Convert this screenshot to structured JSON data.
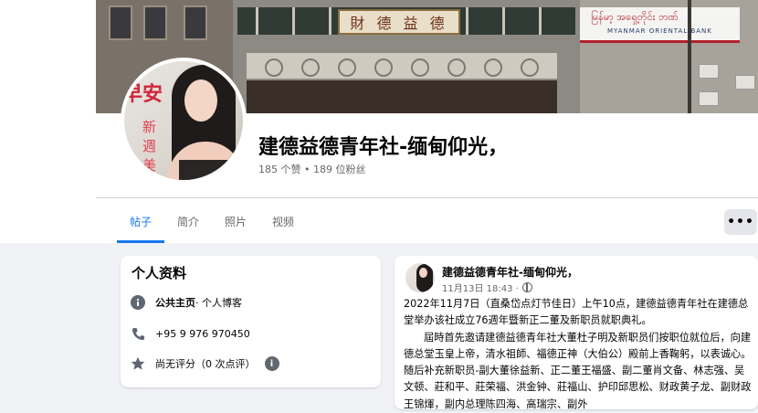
{
  "page": {
    "name": "建德益德青年社-缅甸仰光，",
    "stats": "185 个赞 • 189 位粉丝"
  },
  "cover": {
    "sign_text": "財 德 益 德",
    "bank_line1": "မြန်မာ့ အရှေ့တိုင်း ဘဏ်",
    "bank_line2": "MYANMAR ORIENTAL BANK"
  },
  "avatar": {
    "text_top": "早安",
    "text_side": "新週美"
  },
  "tabs": [
    {
      "label": "帖子",
      "active": true
    },
    {
      "label": "简介",
      "active": false
    },
    {
      "label": "照片",
      "active": false
    },
    {
      "label": "视频",
      "active": false
    }
  ],
  "more_button": "•••",
  "intro": {
    "title": "个人资料",
    "category_bold": "公共主页",
    "category_rest": " · 个人博客",
    "phone": "+95 9 976 970450",
    "rating": "尚无评分（0 次点评）"
  },
  "post": {
    "author": "建德益德青年社-缅甸仰光，",
    "time": "11月13日 18:43 ·",
    "paragraph1": "2022年11月7日（直桑岱点灯节佳日）上午10点，建德益德青年社在建德总堂举办该社成立76週年暨新正二董及新职员就职典礼。",
    "paragraph2": "屆時首先邀请建德益德青年社大董杜子明及新职员们按职位就位后，向建德总堂玉皇上帝，清水祖師、福德正神（大伯公）殿前上香鞠躬，以表诚心。随后补充新职员-副大董徐益新、正二董王福盛、副二董肖文备、林志强、吴文顿、莊和平、莊荣福、洪金钟、莊福山、护印邱思松、财政黄子龙、副财政王锦煇，副内总理陈四海、高瑞宗、副外"
  },
  "colors": {
    "accent": "#1877f2",
    "background": "#f0f2f5",
    "secondary_text": "#65676b"
  }
}
